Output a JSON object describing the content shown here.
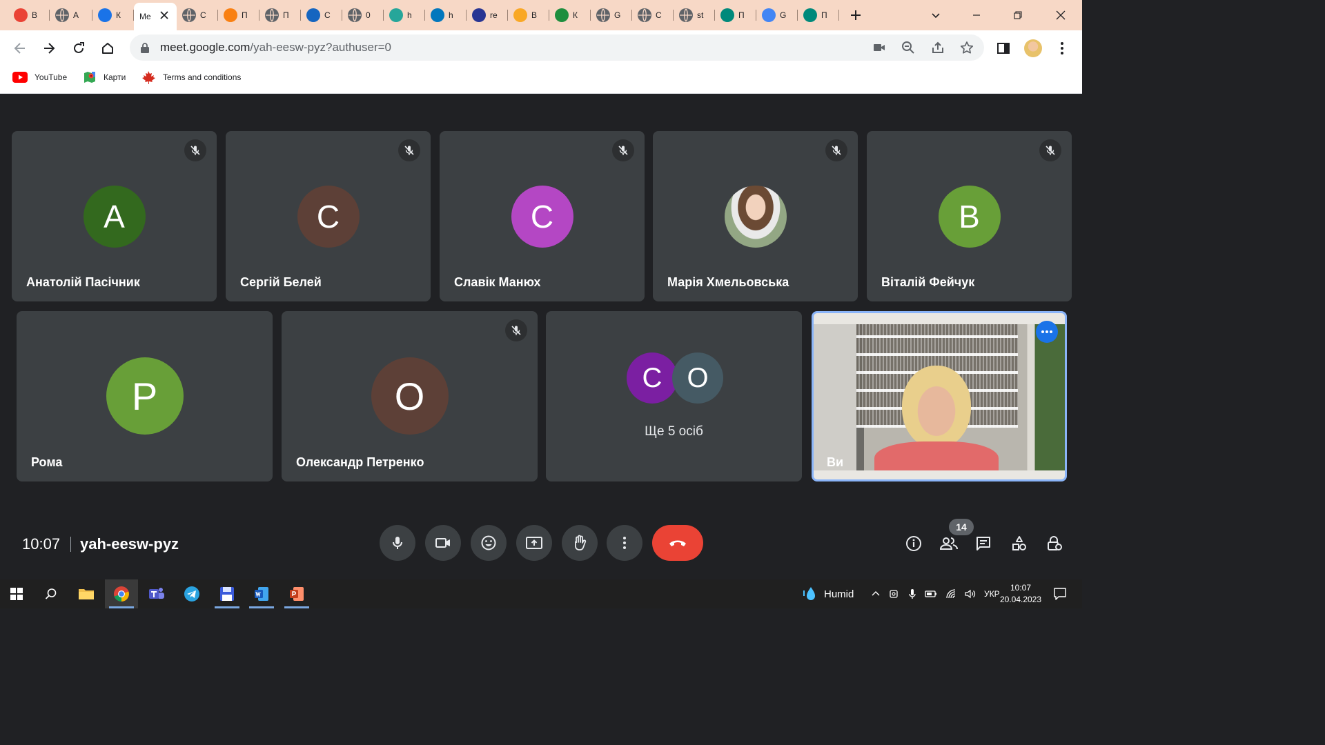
{
  "browser": {
    "tabs": [
      {
        "label": "В",
        "icon": "gmail-icon",
        "color": "#ea4335"
      },
      {
        "label": "А",
        "icon": "globe-icon",
        "color": "#5f6368"
      },
      {
        "label": "К",
        "icon": "calendar-icon",
        "color": "#1a73e8"
      },
      {
        "label": "Me",
        "icon": "google-meet-icon",
        "color": "#00897b",
        "active": true
      },
      {
        "label": "С",
        "icon": "globe-icon",
        "color": "#5f6368"
      },
      {
        "label": "П",
        "icon": "moodle-icon",
        "color": "#f98012"
      },
      {
        "label": "П",
        "icon": "globe-icon",
        "color": "#5f6368"
      },
      {
        "label": "С",
        "icon": "swirl-icon",
        "color": "#1565c0"
      },
      {
        "label": "0",
        "icon": "globe-icon",
        "color": "#5f6368"
      },
      {
        "label": "h",
        "icon": "map-icon",
        "color": "#26a69a"
      },
      {
        "label": "h",
        "icon": "emblem-icon",
        "color": "#0277bd"
      },
      {
        "label": "re",
        "icon": "crest-icon",
        "color": "#283593"
      },
      {
        "label": "В",
        "icon": "104-icon",
        "color": "#f9a825"
      },
      {
        "label": "К",
        "icon": "plus-cross-icon",
        "color": "#1e8e3e"
      },
      {
        "label": "G",
        "icon": "globe-icon",
        "color": "#5f6368"
      },
      {
        "label": "C",
        "icon": "globe-icon",
        "color": "#5f6368"
      },
      {
        "label": "st",
        "icon": "globe-icon",
        "color": "#5f6368"
      },
      {
        "label": "П",
        "icon": "leaf-icon",
        "color": "#00897b"
      },
      {
        "label": "G",
        "icon": "google-icon",
        "color": "#4285f4"
      },
      {
        "label": "П",
        "icon": "leaf-icon",
        "color": "#00897b"
      }
    ],
    "url_host": "meet.google.com",
    "url_path": "/yah-eesw-pyz?authuser=0",
    "bookmarks": [
      {
        "label": "YouTube",
        "icon": "youtube-icon"
      },
      {
        "label": "Карти",
        "icon": "maps-pin-icon"
      },
      {
        "label": "Terms and conditions",
        "icon": "maple-leaf-icon"
      }
    ]
  },
  "meet": {
    "participants_row1": [
      {
        "name": "Анатолій Пасічник",
        "initial": "А",
        "color": "#33691e",
        "muted": true
      },
      {
        "name": "Сергій Белей",
        "initial": "С",
        "color": "#5d4037",
        "muted": true
      },
      {
        "name": "Славік Манюх",
        "initial": "С",
        "color": "#b447c4",
        "muted": true
      },
      {
        "name": "Марія Хмельовська",
        "initial": "",
        "color": "#8d6e63",
        "muted": true,
        "photo": true
      },
      {
        "name": "Віталій Фейчук",
        "initial": "В",
        "color": "#689f38",
        "muted": true
      }
    ],
    "participants_row2": [
      {
        "name": "Рома",
        "initial": "Р",
        "color": "#689f38",
        "muted": false
      },
      {
        "name": "Олександр Петренко",
        "initial": "О",
        "color": "#5d4037",
        "muted": true
      }
    ],
    "others": {
      "label": "Ще 5 осіб",
      "initials": [
        {
          "initial": "С",
          "color": "#7b1fa2"
        },
        {
          "initial": "О",
          "color": "#455a64"
        }
      ]
    },
    "self": {
      "name": "Ви"
    },
    "time": "10:07",
    "meeting_code": "yah-eesw-pyz",
    "participant_count": "14"
  },
  "taskbar": {
    "weather": "Humid",
    "language": "УКР",
    "time": "10:07",
    "date": "20.04.2023"
  }
}
